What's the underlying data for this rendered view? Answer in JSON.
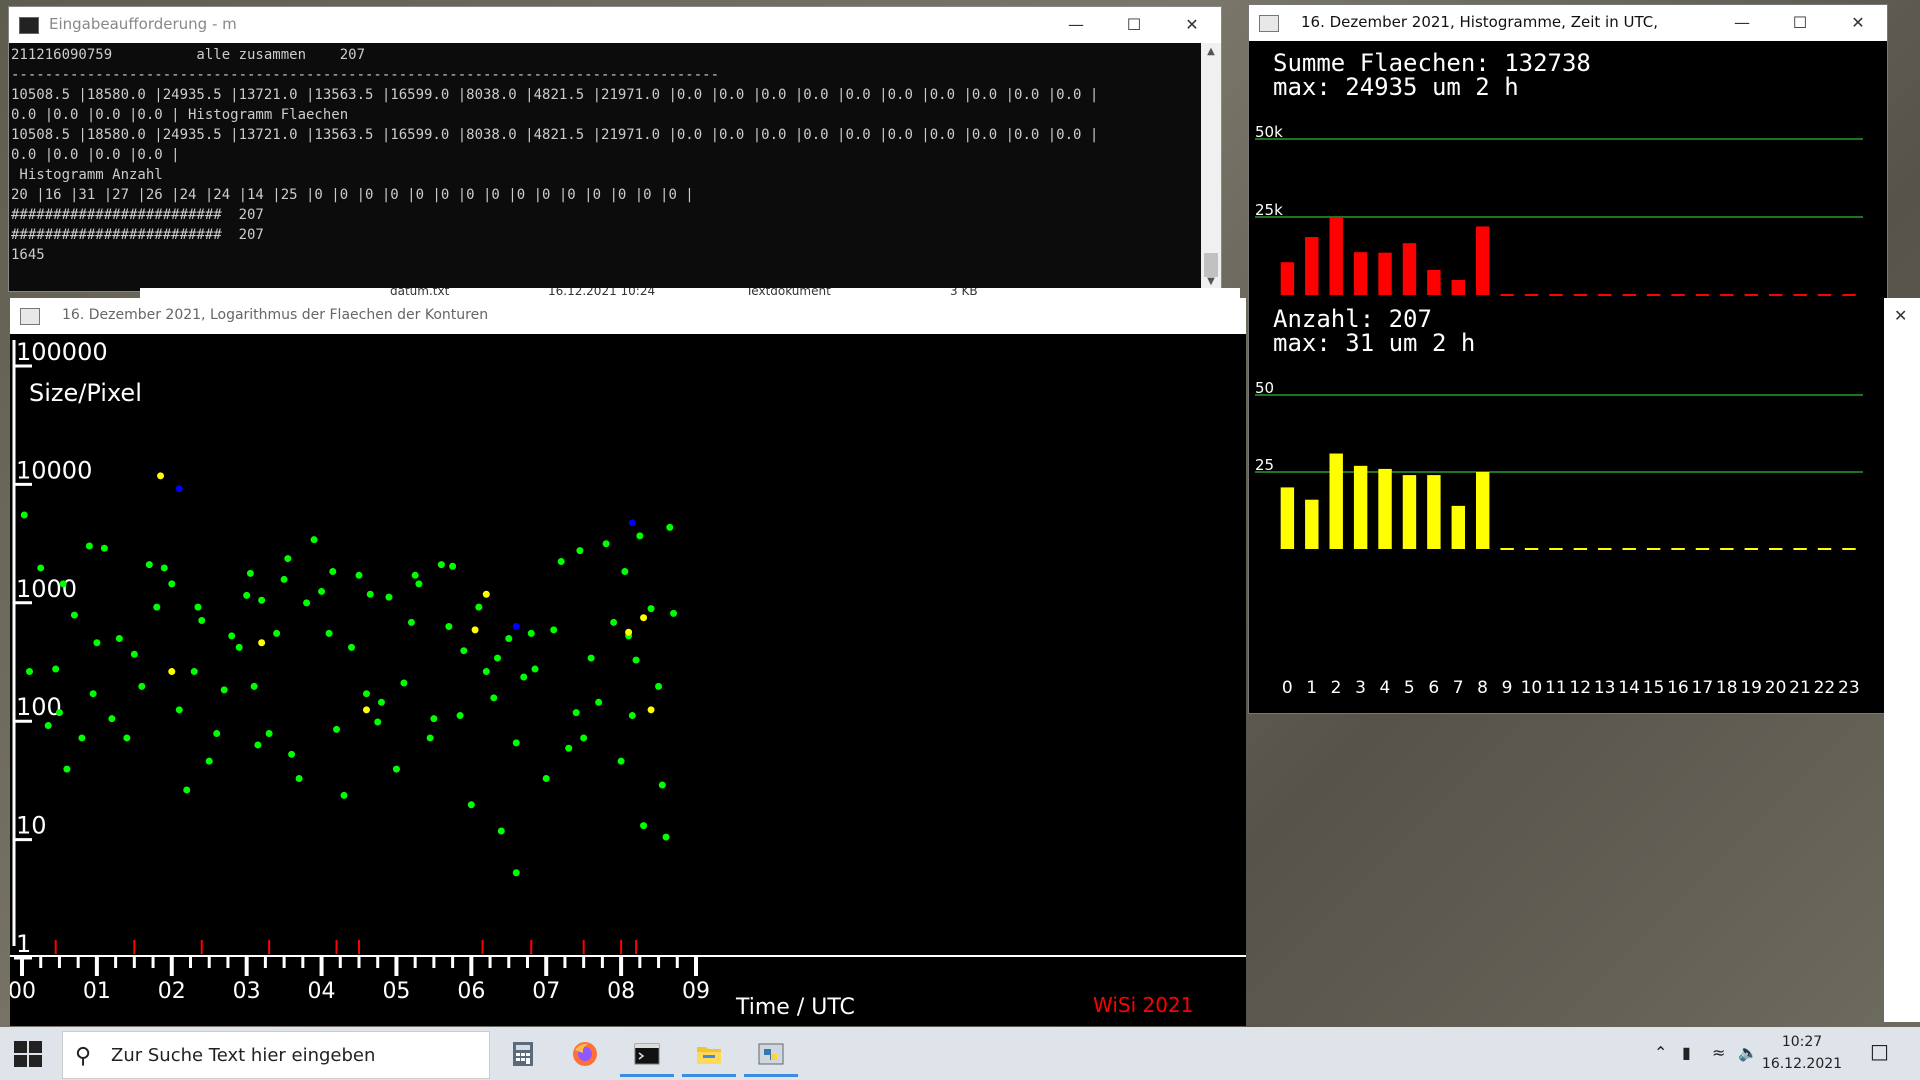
{
  "cmd_window": {
    "title": "Eingabeaufforderung - m",
    "lines": [
      "211216090759          alle zusammen    207",
      "------------------------------------------------------------------------------------",
      "10508.5 |18580.0 |24935.5 |13721.0 |13563.5 |16599.0 |8038.0 |4821.5 |21971.0 |0.0 |0.0 |0.0 |0.0 |0.0 |0.0 |0.0 |0.0 |0.0 |0.0 |",
      "0.0 |0.0 |0.0 |0.0 | Histogramm Flaechen",
      "10508.5 |18580.0 |24935.5 |13721.0 |13563.5 |16599.0 |8038.0 |4821.5 |21971.0 |0.0 |0.0 |0.0 |0.0 |0.0 |0.0 |0.0 |0.0 |0.0 |0.0 |",
      "0.0 |0.0 |0.0 |0.0 |",
      " Histogramm Anzahl",
      "20 |16 |31 |27 |26 |24 |24 |14 |25 |0 |0 |0 |0 |0 |0 |0 |0 |0 |0 |0 |0 |0 |0 |0 |",
      "#########################  207",
      "#########################  207",
      "1645"
    ]
  },
  "explorer_strip": {
    "name": "datum.txt",
    "date": "16.12.2021 10:24",
    "type": "Textdokument",
    "size": "3 KB"
  },
  "log_window": {
    "title": "16. Dezember 2021, Logarithmus der Flaechen der Konturen"
  },
  "hist_window": {
    "title": "16. Dezember 2021, Histogramme, Zeit in UTC,"
  },
  "chart_data": [
    {
      "type": "scatter",
      "title": "16. Dezember 2021, Logarithmus der Flaechen der Konturen",
      "ylabel": "Size/Pixel",
      "xlabel": "Time  /  UTC",
      "yscale": "log",
      "ylim": [
        1,
        100000
      ],
      "xlim": [
        0,
        9
      ],
      "y_ticks": [
        "100000",
        "10000",
        "1000",
        "100",
        "10",
        "1"
      ],
      "x_ticks": [
        "00",
        "01",
        "02",
        "03",
        "04",
        "05",
        "06",
        "07",
        "08",
        "09"
      ],
      "watermark": "WiSi 2021",
      "colors": {
        "normal": "#00ff00",
        "large": "#ffff00",
        "special": "#0000ff",
        "marker": "#ff0000"
      },
      "series": [
        {
          "name": "green",
          "points": [
            [
              0.03,
              4200
            ],
            [
              0.25,
              1500
            ],
            [
              0.5,
              90
            ],
            [
              0.45,
              210
            ],
            [
              0.8,
              55
            ],
            [
              0.9,
              2300
            ],
            [
              1.0,
              350
            ],
            [
              1.5,
              280
            ],
            [
              1.9,
              1500
            ],
            [
              2.0,
              1100
            ],
            [
              2.3,
              200
            ],
            [
              2.6,
              60
            ],
            [
              2.8,
              400
            ],
            [
              3.1,
              150
            ],
            [
              3.2,
              800
            ],
            [
              3.5,
              1200
            ],
            [
              3.9,
              2600
            ],
            [
              4.1,
              420
            ],
            [
              4.4,
              320
            ],
            [
              4.8,
              110
            ],
            [
              5.2,
              520
            ],
            [
              5.6,
              1600
            ],
            [
              5.9,
              300
            ],
            [
              6.3,
              120
            ],
            [
              6.6,
              50
            ],
            [
              6.8,
              420
            ],
            [
              7.2,
              1700
            ],
            [
              7.4,
              90
            ],
            [
              7.8,
              2400
            ],
            [
              8.05,
              1400
            ],
            [
              8.1,
              400
            ],
            [
              8.2,
              250
            ],
            [
              8.5,
              150
            ],
            [
              8.7,
              620
            ],
            [
              0.6,
              30
            ],
            [
              1.2,
              80
            ],
            [
              1.6,
              150
            ],
            [
              2.2,
              20
            ],
            [
              2.7,
              140
            ],
            [
              3.3,
              60
            ],
            [
              3.6,
              40
            ],
            [
              4.3,
              18
            ],
            [
              4.6,
              130
            ],
            [
              5.0,
              30
            ],
            [
              5.5,
              80
            ],
            [
              6.0,
              15
            ],
            [
              6.4,
              9
            ],
            [
              6.6,
              4
            ],
            [
              7.0,
              25
            ],
            [
              7.5,
              55
            ],
            [
              8.0,
              35
            ],
            [
              8.3,
              10
            ],
            [
              8.6,
              8
            ],
            [
              0.1,
              200
            ],
            [
              0.7,
              600
            ],
            [
              1.3,
              380
            ],
            [
              1.8,
              700
            ],
            [
              2.4,
              540
            ],
            [
              2.9,
              320
            ],
            [
              3.0,
              880
            ],
            [
              3.4,
              420
            ],
            [
              3.8,
              760
            ],
            [
              4.0,
              950
            ],
            [
              4.5,
              1300
            ],
            [
              4.9,
              850
            ],
            [
              5.3,
              1100
            ],
            [
              5.7,
              480
            ],
            [
              6.1,
              700
            ],
            [
              6.5,
              380
            ],
            [
              7.1,
              450
            ],
            [
              7.6,
              260
            ],
            [
              7.9,
              520
            ],
            [
              8.4,
              680
            ],
            [
              0.35,
              70
            ],
            [
              0.95,
              130
            ],
            [
              1.4,
              55
            ],
            [
              2.1,
              95
            ],
            [
              2.5,
              35
            ],
            [
              3.15,
              48
            ],
            [
              3.7,
              25
            ],
            [
              4.2,
              65
            ],
            [
              4.75,
              75
            ],
            [
              5.1,
              160
            ],
            [
              5.45,
              55
            ],
            [
              5.85,
              85
            ],
            [
              6.2,
              200
            ],
            [
              6.7,
              180
            ],
            [
              7.3,
              45
            ],
            [
              7.7,
              110
            ],
            [
              8.15,
              85
            ],
            [
              8.55,
              22
            ],
            [
              0.55,
              1100
            ],
            [
              1.1,
              2200
            ],
            [
              1.7,
              1600
            ],
            [
              2.35,
              700
            ],
            [
              3.05,
              1350
            ],
            [
              3.55,
              1800
            ],
            [
              4.15,
              1400
            ],
            [
              4.65,
              900
            ],
            [
              5.25,
              1300
            ],
            [
              5.75,
              1550
            ],
            [
              6.35,
              260
            ],
            [
              6.85,
              210
            ],
            [
              7.45,
              2100
            ],
            [
              8.25,
              2800
            ],
            [
              8.65,
              3300
            ]
          ]
        },
        {
          "name": "yellow",
          "points": [
            [
              1.85,
              9000
            ],
            [
              2.0,
              200
            ],
            [
              3.2,
              350
            ],
            [
              4.6,
              95
            ],
            [
              6.05,
              450
            ],
            [
              6.2,
              900
            ],
            [
              8.1,
              430
            ],
            [
              8.3,
              570
            ],
            [
              8.4,
              95
            ]
          ]
        },
        {
          "name": "blue",
          "points": [
            [
              2.1,
              7000
            ],
            [
              8.15,
              3600
            ],
            [
              6.6,
              480
            ]
          ]
        }
      ],
      "time_markers": [
        0.45,
        1.5,
        2.4,
        3.3,
        4.2,
        4.5,
        6.15,
        6.8,
        7.5,
        8.0,
        8.2
      ]
    },
    {
      "type": "bar",
      "title": "Summe Flaechen: 132738",
      "subtitle": "max: 24935 um 2 h",
      "categories": [
        "0",
        "1",
        "2",
        "3",
        "4",
        "5",
        "6",
        "7",
        "8",
        "9",
        "10",
        "11",
        "12",
        "13",
        "14",
        "15",
        "16",
        "17",
        "18",
        "19",
        "20",
        "21",
        "22",
        "23"
      ],
      "values": [
        10508.5,
        18580.0,
        24935.5,
        13721.0,
        13563.5,
        16599.0,
        8038.0,
        4821.5,
        21971.0,
        0,
        0,
        0,
        0,
        0,
        0,
        0,
        0,
        0,
        0,
        0,
        0,
        0,
        0,
        0
      ],
      "ylim": [
        0,
        50000
      ],
      "y_ticks": [
        "50k",
        "25k"
      ],
      "y_tick_values": [
        50000,
        25000
      ],
      "color": "#ff0000"
    },
    {
      "type": "bar",
      "title": "Anzahl: 207",
      "subtitle": "max: 31 um 2 h",
      "categories": [
        "0",
        "1",
        "2",
        "3",
        "4",
        "5",
        "6",
        "7",
        "8",
        "9",
        "10",
        "11",
        "12",
        "13",
        "14",
        "15",
        "16",
        "17",
        "18",
        "19",
        "20",
        "21",
        "22",
        "23"
      ],
      "values": [
        20,
        16,
        31,
        27,
        26,
        24,
        24,
        14,
        25,
        0,
        0,
        0,
        0,
        0,
        0,
        0,
        0,
        0,
        0,
        0,
        0,
        0,
        0,
        0
      ],
      "ylim": [
        0,
        50
      ],
      "y_ticks": [
        "50",
        "25"
      ],
      "y_tick_values": [
        50,
        25
      ],
      "color": "#ffff00"
    }
  ],
  "taskbar": {
    "search_placeholder": "Zur Suche Text hier eingeben",
    "time": "10:27",
    "date": "16.12.2021",
    "apps": [
      "calculator-icon",
      "firefox-icon",
      "terminal-icon",
      "file-explorer-icon",
      "python-icon"
    ]
  }
}
